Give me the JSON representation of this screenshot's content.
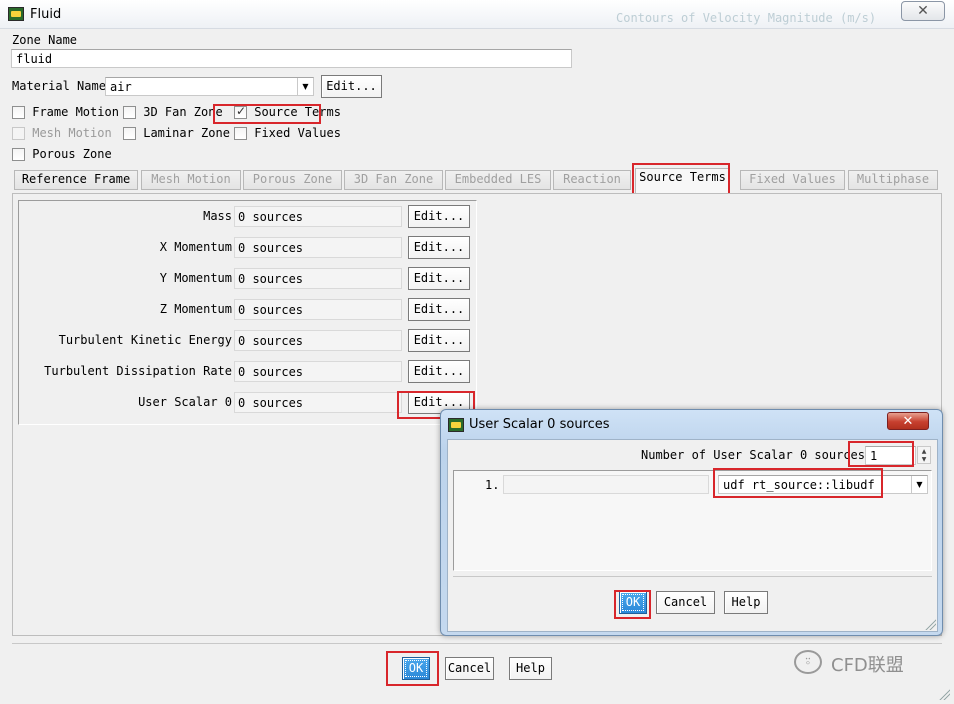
{
  "window": {
    "title": "Fluid",
    "close_glyph": "✕",
    "bg_title_text": "Contours of Velocity Magnitude (m/s)"
  },
  "zone": {
    "zone_name_label": "Zone Name",
    "zone_name_value": "fluid",
    "material_label": "Material Name",
    "material_value": "air",
    "material_edit": "Edit..."
  },
  "options": {
    "frame_motion": {
      "label": "Frame Motion",
      "checked": false
    },
    "fan_zone_3d": {
      "label": "3D Fan Zone",
      "checked": false
    },
    "source_terms": {
      "label": "Source Terms",
      "checked": true
    },
    "mesh_motion": {
      "label": "Mesh Motion",
      "checked": false,
      "disabled": true
    },
    "laminar_zone": {
      "label": "Laminar Zone",
      "checked": false
    },
    "fixed_values": {
      "label": "Fixed Values",
      "checked": false
    },
    "porous_zone": {
      "label": "Porous Zone",
      "checked": false
    }
  },
  "tabs": [
    {
      "label": "Reference Frame"
    },
    {
      "label": "Mesh Motion"
    },
    {
      "label": "Porous Zone"
    },
    {
      "label": "3D Fan Zone"
    },
    {
      "label": "Embedded LES"
    },
    {
      "label": "Reaction"
    },
    {
      "label": "Source Terms"
    },
    {
      "label": "Fixed Values"
    },
    {
      "label": "Multiphase"
    }
  ],
  "active_tab": "Source Terms",
  "sources": [
    {
      "label": "Mass",
      "value": "0 sources",
      "edit": "Edit..."
    },
    {
      "label": "X Momentum",
      "value": "0 sources",
      "edit": "Edit..."
    },
    {
      "label": "Y Momentum",
      "value": "0 sources",
      "edit": "Edit..."
    },
    {
      "label": "Z Momentum",
      "value": "0 sources",
      "edit": "Edit..."
    },
    {
      "label": "Turbulent Kinetic Energy",
      "value": "0 sources",
      "edit": "Edit..."
    },
    {
      "label": "Turbulent Dissipation Rate",
      "value": "0 sources",
      "edit": "Edit..."
    },
    {
      "label": "User Scalar 0",
      "value": "0 sources",
      "edit": "Edit..."
    }
  ],
  "footer": {
    "ok": "OK",
    "cancel": "Cancel",
    "help": "Help"
  },
  "sub_dialog": {
    "title": "User Scalar 0 sources",
    "close_glyph": "✕",
    "count_label": "Number of User Scalar 0 sources",
    "count_value": "1",
    "spin_up": "▲",
    "spin_down": "▼",
    "entries": [
      {
        "index": "1.",
        "value": "udf rt_source::libudf"
      }
    ],
    "ok": "OK",
    "cancel": "Cancel",
    "help": "Help"
  },
  "watermark": {
    "text": "CFD联盟",
    "icon": "wechat-icon",
    "icon_glyph": "⍤"
  },
  "colors": {
    "highlight_red": "#d8262b",
    "ok_blue": "#2b88d8"
  }
}
